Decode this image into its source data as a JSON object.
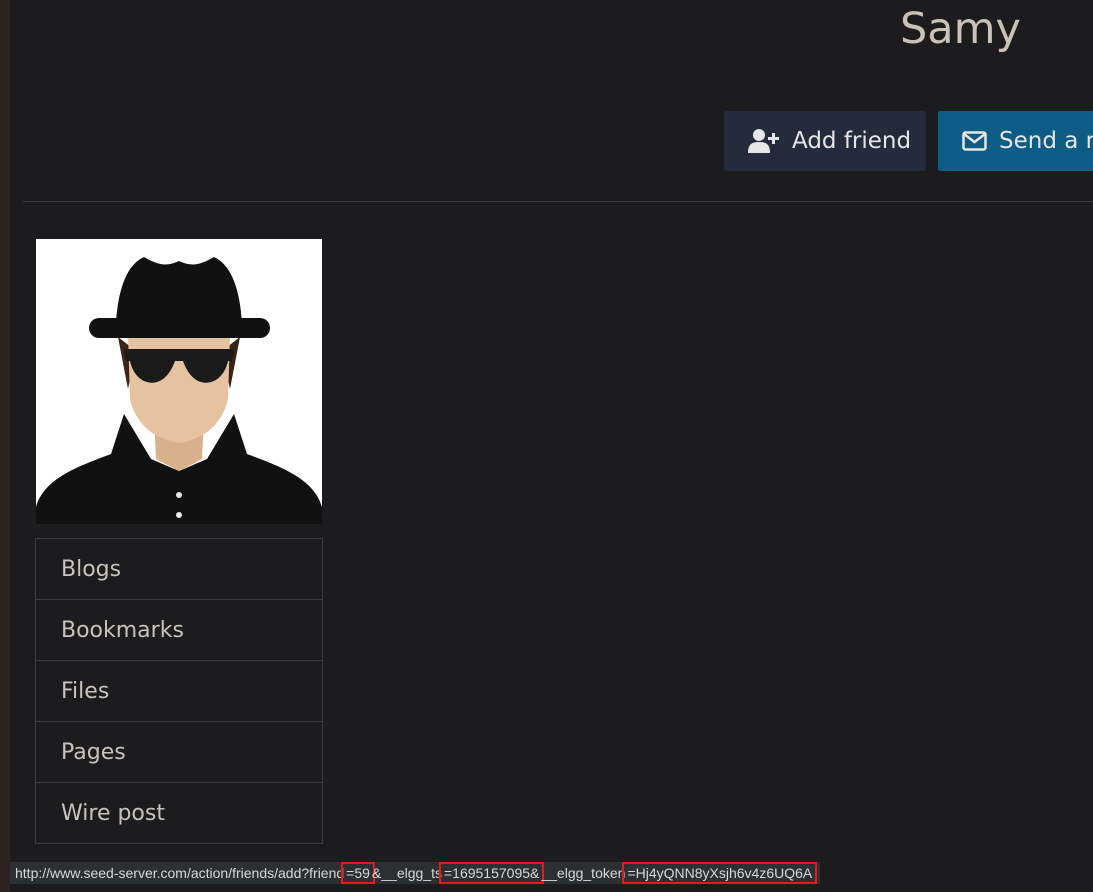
{
  "profile": {
    "name": "Samy"
  },
  "actions": {
    "add_friend_label": "Add friend",
    "send_message_label": "Send a m"
  },
  "menu": {
    "items": [
      {
        "label": "Blogs"
      },
      {
        "label": "Bookmarks"
      },
      {
        "label": "Files"
      },
      {
        "label": "Pages"
      },
      {
        "label": "Wire post"
      }
    ]
  },
  "status_url": {
    "part1": "http://www.seed-server.com/action/friends/add?friend",
    "friend_value": "=59",
    "part2": "&__elgg_ts",
    "ts_value": "=1695157095&",
    "part3": "__elgg_token",
    "token_value": "=Hj4yQNN8yXsjh6v4z6UQ6A"
  },
  "colors": {
    "background": "#1c1b1e",
    "add_button": "#262a3d",
    "send_button": "#0d5c86",
    "highlight": "#e31b1b"
  },
  "icons": {
    "add_friend": "user-plus-icon",
    "send_message": "envelope-icon"
  }
}
